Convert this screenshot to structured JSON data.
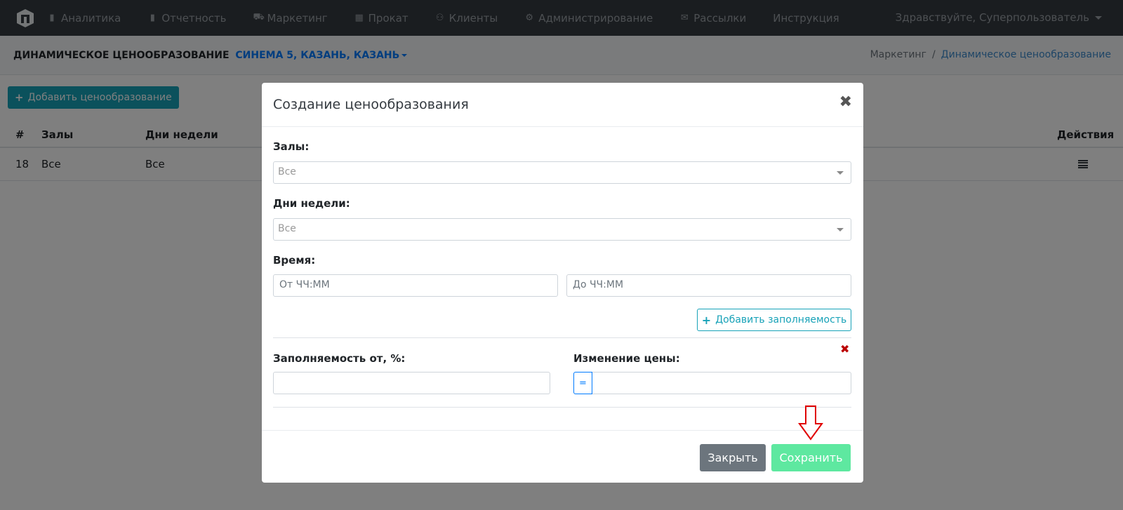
{
  "nav": {
    "items": [
      {
        "icon": "bar-chart-icon",
        "glyph": "▮",
        "label": "Аналитика"
      },
      {
        "icon": "bar-chart-icon",
        "glyph": "▮",
        "label": "Отчетность"
      },
      {
        "icon": "cart-icon",
        "glyph": "⛟",
        "label": "Маркетинг"
      },
      {
        "icon": "film-icon",
        "glyph": "▦",
        "label": "Прокат"
      },
      {
        "icon": "user-icon",
        "glyph": "⚇",
        "label": "Клиенты"
      },
      {
        "icon": "gears-icon",
        "glyph": "⚙",
        "label": "Администрирование"
      },
      {
        "icon": "envelope-icon",
        "glyph": "✉",
        "label": "Рассылки"
      },
      {
        "icon": "",
        "glyph": "",
        "label": "Инструкция"
      }
    ],
    "user_greeting": "Здравствуйте, Суперпользователь"
  },
  "header": {
    "title": "ДИНАМИЧЕСКОЕ ЦЕНООБРАЗОВАНИЕ",
    "cinema": "СИНЕМА 5, КАЗАНЬ, КАЗАНЬ",
    "breadcrumb": {
      "parent": "Маркетинг",
      "separator": "/",
      "current": "Динамическое ценообразование"
    }
  },
  "content": {
    "add_button": "Добавить ценообразование",
    "table": {
      "columns": [
        "#",
        "Залы",
        "Дни недели",
        "Действия"
      ],
      "rows": [
        {
          "id": "18",
          "halls": "Все",
          "days": "Все"
        }
      ]
    }
  },
  "modal": {
    "title": "Создание ценообразования",
    "close_glyph": "✖",
    "halls_label": "Залы:",
    "halls_value": "Все",
    "days_label": "Дни недели:",
    "days_value": "Все",
    "time_label": "Время:",
    "time_from_placeholder": "От ЧЧ:ММ",
    "time_to_placeholder": "До ЧЧ:ММ",
    "add_occupancy_button": "Добавить заполняемость",
    "occupancy_label": "Заполняемость от, %:",
    "price_change_label": "Изменение цены:",
    "price_operator": "=",
    "remove_glyph": "✖",
    "close_button": "Закрыть",
    "save_button": "Сохранить"
  },
  "colors": {
    "navbar": "#343a40",
    "accent": "#17a2b8",
    "link": "#007bff",
    "save": "#5ee8a0",
    "annotation_arrow": "#e00000"
  }
}
